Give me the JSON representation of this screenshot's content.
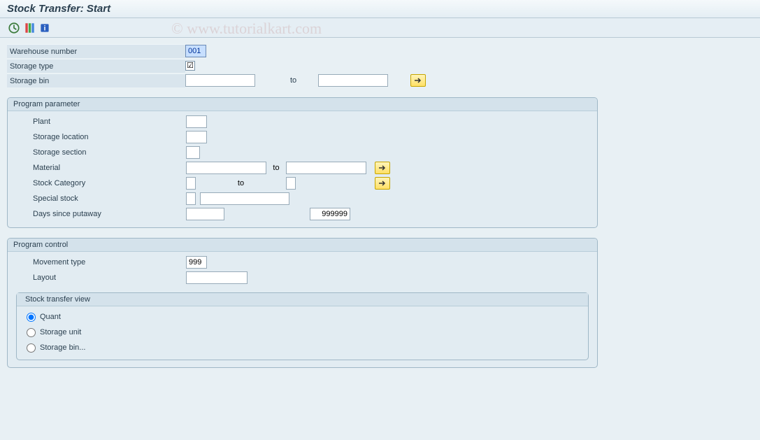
{
  "title": "Stock Transfer: Start",
  "watermark": "© www.tutorialkart.com",
  "top": {
    "warehouse_number_label": "Warehouse number",
    "warehouse_number_value": "001",
    "storage_type_label": "Storage type",
    "storage_type_checked": "☑",
    "storage_bin_label": "Storage bin",
    "storage_bin_from": "",
    "to_label": "to",
    "storage_bin_to": ""
  },
  "group1": {
    "title": "Program parameter",
    "plant_label": "Plant",
    "plant_value": "",
    "storage_location_label": "Storage location",
    "storage_location_value": "",
    "storage_section_label": "Storage section",
    "storage_section_value": "",
    "material_label": "Material",
    "material_from": "",
    "to_label": "to",
    "material_to": "",
    "stock_category_label": "Stock Category",
    "stock_category_from": "",
    "stock_category_to": "",
    "special_stock_label": "Special stock",
    "special_stock_code": "",
    "special_stock_value": "",
    "days_label": "Days since putaway",
    "days_from": "",
    "days_to": "999999"
  },
  "group2": {
    "title": "Program control",
    "movement_type_label": "Movement type",
    "movement_type_value": "999",
    "layout_label": "Layout",
    "layout_value": "",
    "view_title": "Stock transfer view",
    "radio1": "Quant",
    "radio2": "Storage unit",
    "radio3": "Storage bin..."
  }
}
